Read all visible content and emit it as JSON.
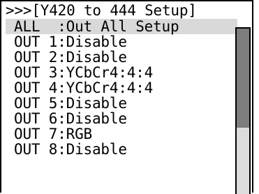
{
  "screen": {
    "title": ">>>[Y420 to 444 Setup]"
  },
  "menu": {
    "items": [
      {
        "label": "ALL  :Out All Setup",
        "selected": true
      },
      {
        "label": "OUT 1:Disable",
        "selected": false
      },
      {
        "label": "OUT 2:Disable",
        "selected": false
      },
      {
        "label": "OUT 3:YCbCr4:4:4",
        "selected": false
      },
      {
        "label": "OUT 4:YCbCr4:4:4",
        "selected": false
      },
      {
        "label": "OUT 5:Disable",
        "selected": false
      },
      {
        "label": "OUT 6:Disable",
        "selected": false
      },
      {
        "label": "OUT 7:RGB",
        "selected": false
      },
      {
        "label": "OUT 8:Disable",
        "selected": false
      }
    ]
  },
  "scrollbar": {
    "visible_fraction": 0.6,
    "position_fraction": 0
  },
  "colors": {
    "selection": "#d9d9d9",
    "scroll_thumb": "#7d7d7d",
    "scroll_track": "#dcdcdc"
  }
}
